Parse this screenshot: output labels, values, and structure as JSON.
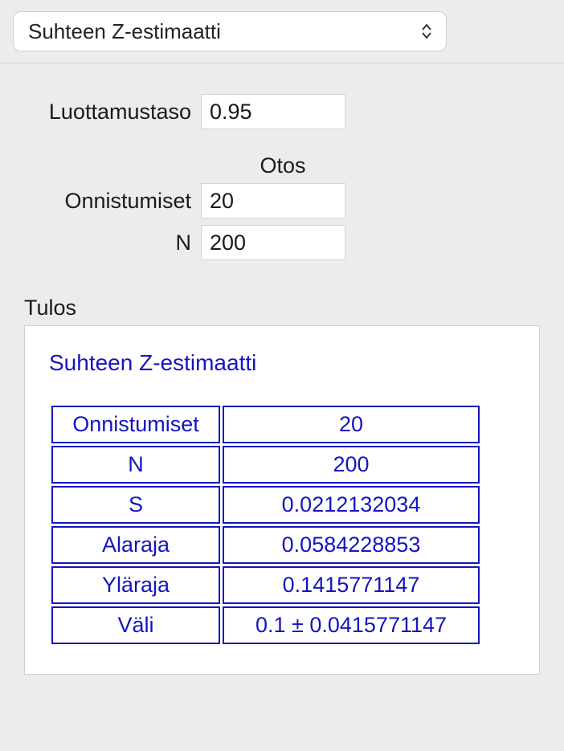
{
  "toolbar": {
    "selected": "Suhteen Z-estimaatti"
  },
  "inputs": {
    "confidence_label": "Luottamustaso",
    "confidence_value": "0.95",
    "sample_header": "Otos",
    "successes_label": "Onnistumiset",
    "successes_value": "20",
    "n_label": "N",
    "n_value": "200"
  },
  "result": {
    "section_label": "Tulos",
    "title": "Suhteen Z-estimaatti",
    "rows": [
      {
        "label": "Onnistumiset",
        "value": "20"
      },
      {
        "label": "N",
        "value": "200"
      },
      {
        "label": "S",
        "value": "0.0212132034"
      },
      {
        "label": "Alaraja",
        "value": "0.0584228853"
      },
      {
        "label": "Yläraja",
        "value": "0.1415771147"
      },
      {
        "label": "Väli",
        "value": "0.1 ± 0.0415771147"
      }
    ]
  }
}
